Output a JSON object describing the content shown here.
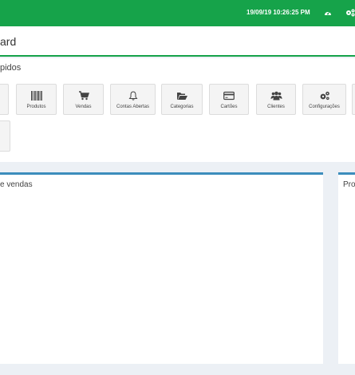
{
  "topbar": {
    "datetime": "19/09/19 10:26:25 PM",
    "icons": [
      "dashboard-icon",
      "settings-icon"
    ]
  },
  "header": {
    "title": "ard"
  },
  "shortcuts": {
    "heading": "pidos",
    "tiles": [
      {
        "label": "Produtos",
        "icon": "barcode-icon"
      },
      {
        "label": "Vendas",
        "icon": "cart-icon"
      },
      {
        "label": "Contas Abertas",
        "icon": "bell-icon"
      },
      {
        "label": "Categorias",
        "icon": "folder-open-icon"
      },
      {
        "label": "Cartões",
        "icon": "credit-card-icon"
      },
      {
        "label": "Clientes",
        "icon": "users-icon"
      },
      {
        "label": "Configurações",
        "icon": "cogs-icon"
      }
    ]
  },
  "panels": {
    "sales": {
      "title": "e vendas"
    },
    "products": {
      "title": "Pro"
    }
  },
  "colors": {
    "brand": "#16a34a",
    "panel_accent": "#3c8dbc",
    "background": "#ecf0f5"
  }
}
